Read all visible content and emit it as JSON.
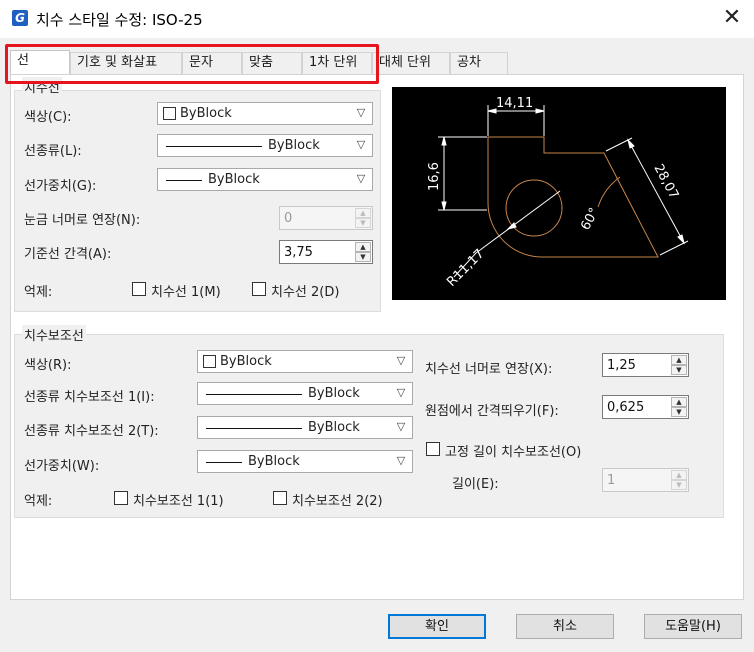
{
  "window": {
    "title": "치수 스타일 수정: ISO-25",
    "close_glyph": "✕",
    "icon_letter": "G"
  },
  "tabs": [
    {
      "label": "선",
      "active": true
    },
    {
      "label": "기호 및 화살표"
    },
    {
      "label": "문자"
    },
    {
      "label": "맞춤"
    },
    {
      "label": "1차 단위"
    },
    {
      "label": "대체 단위"
    },
    {
      "label": "공차"
    }
  ],
  "dim_lines": {
    "title": "치수선",
    "color_label": "색상(C):",
    "color_value": "ByBlock",
    "linetype_label": "선종류(L):",
    "linetype_value": "ByBlock",
    "lineweight_label": "선가중치(G):",
    "lineweight_value": "ByBlock",
    "extend_label": "눈금 너머로 연장(N):",
    "extend_value": "0",
    "baseline_label": "기준선 간격(A):",
    "baseline_value": "3,75",
    "suppress_label": "억제:",
    "suppress1_label": "치수선 1(M)",
    "suppress2_label": "치수선 2(D)"
  },
  "ext_lines": {
    "title": "치수보조선",
    "color_label": "색상(R):",
    "color_value": "ByBlock",
    "linetype1_label": "선종류 치수보조선 1(I):",
    "linetype1_value": "ByBlock",
    "linetype2_label": "선종류 치수보조선 2(T):",
    "linetype2_value": "ByBlock",
    "lineweight_label": "선가중치(W):",
    "lineweight_value": "ByBlock",
    "suppress_label": "억제:",
    "suppress1_label": "치수보조선 1(1)",
    "suppress2_label": "치수보조선 2(2)",
    "extend_label": "치수선 너머로 연장(X):",
    "extend_value": "1,25",
    "offset_label": "원점에서 간격띄우기(F):",
    "offset_value": "0,625",
    "fixed_label": "고정 길이 치수보조선(O)",
    "length_label": "길이(E):",
    "length_value": "1"
  },
  "preview": {
    "dim_top": "14,11",
    "dim_left": "16,6",
    "dim_diag": "28,07",
    "dim_angle": "60°",
    "dim_radius": "R11,17"
  },
  "buttons": {
    "ok": "확인",
    "cancel": "취소",
    "help": "도움말(H)"
  },
  "colors": {
    "highlight": "#e6141c",
    "preview_bg": "#000000",
    "preview_geometry": "#c8864a",
    "preview_dims": "#ffffff"
  }
}
